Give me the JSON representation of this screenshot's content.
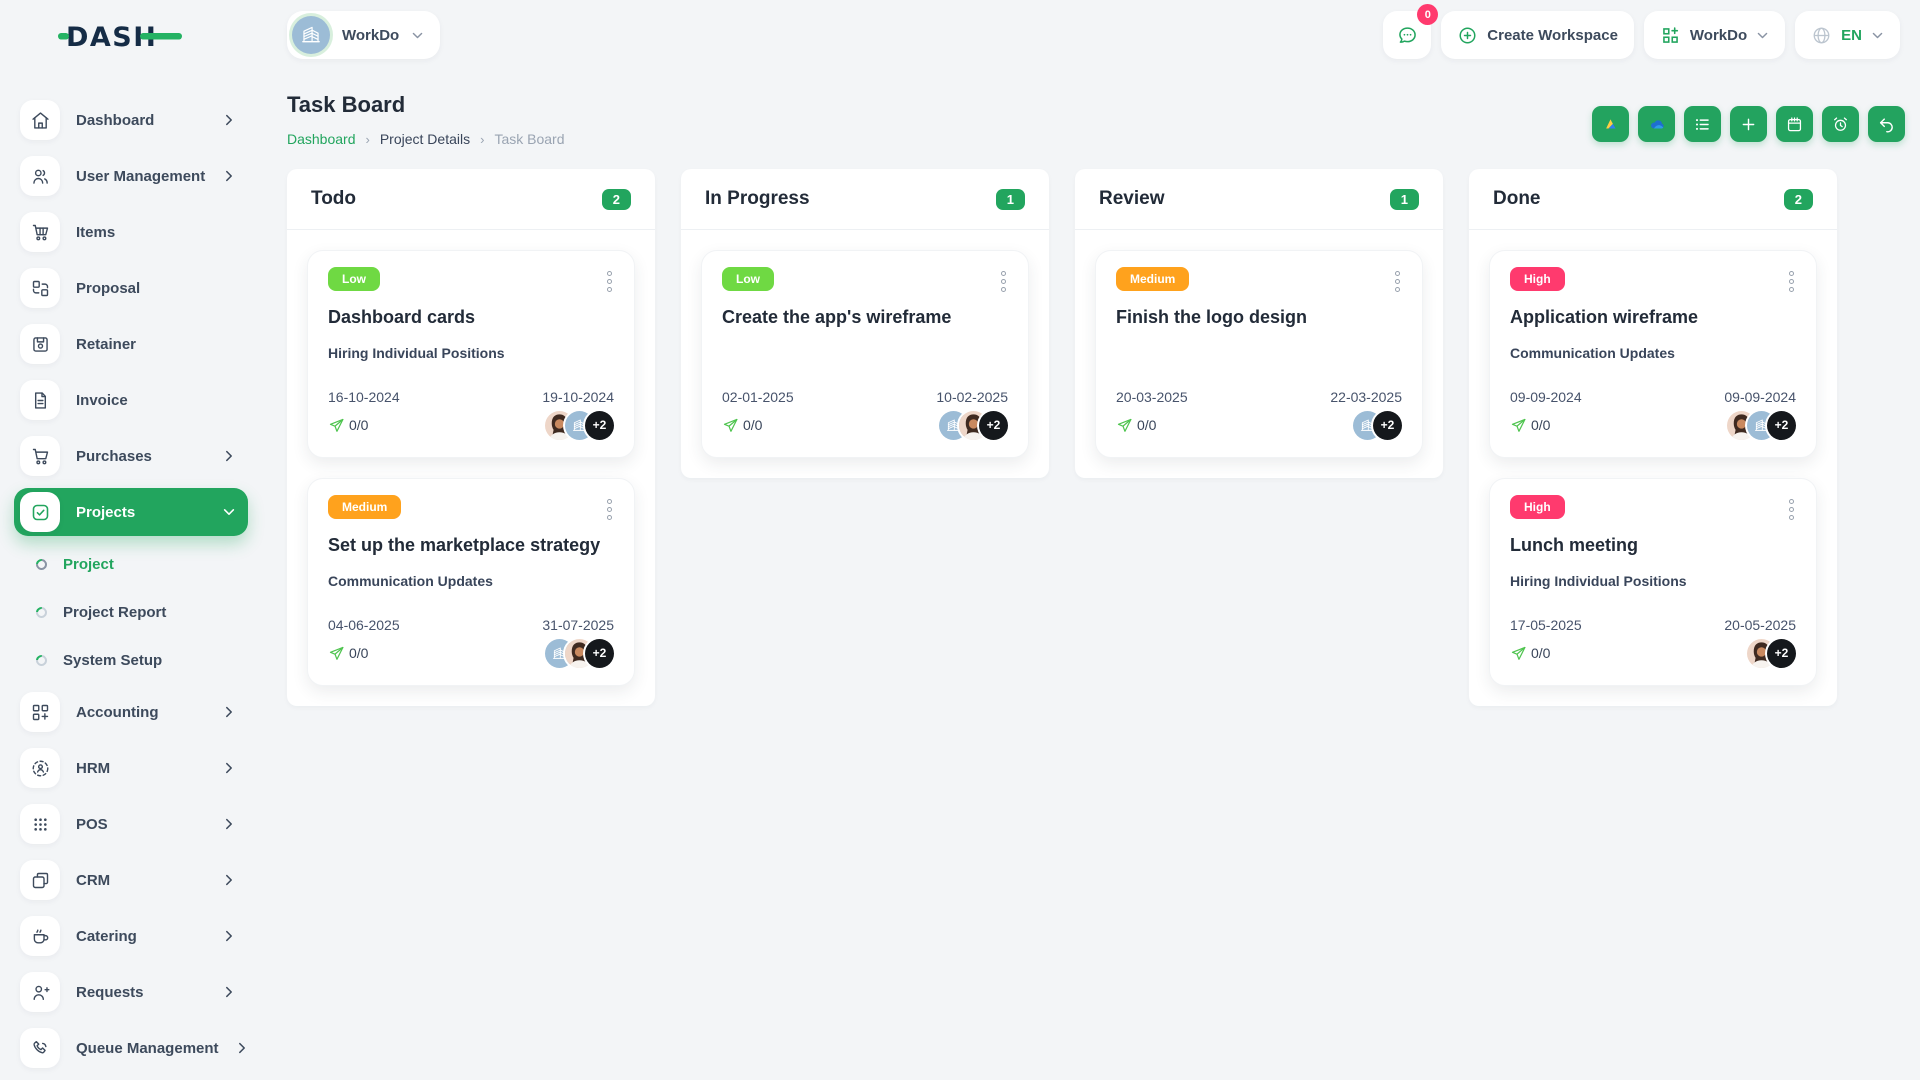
{
  "brand": {
    "logo_text": "DASH"
  },
  "header": {
    "workspace": {
      "label": "WorkDo"
    },
    "chat": {
      "badge": "0"
    },
    "create_workspace": {
      "label": "Create Workspace"
    },
    "app_switcher": {
      "label": "WorkDo"
    },
    "language": {
      "label": "EN"
    }
  },
  "sidebar": {
    "items": [
      {
        "label": "Dashboard"
      },
      {
        "label": "User Management"
      },
      {
        "label": "Items"
      },
      {
        "label": "Proposal"
      },
      {
        "label": "Retainer"
      },
      {
        "label": "Invoice"
      },
      {
        "label": "Purchases"
      },
      {
        "label": "Projects",
        "children": [
          {
            "label": "Project"
          },
          {
            "label": "Project Report"
          },
          {
            "label": "System Setup"
          }
        ]
      },
      {
        "label": "Accounting"
      },
      {
        "label": "HRM"
      },
      {
        "label": "POS"
      },
      {
        "label": "CRM"
      },
      {
        "label": "Catering"
      },
      {
        "label": "Requests"
      },
      {
        "label": "Queue Management"
      }
    ]
  },
  "page": {
    "title": "Task Board",
    "breadcrumb": [
      {
        "label": "Dashboard"
      },
      {
        "label": "Project Details"
      },
      {
        "label": "Task Board"
      }
    ]
  },
  "toolbar": {
    "buttons": [
      "google-drive",
      "onedrive",
      "list-view",
      "add-task",
      "calendar",
      "duration",
      "back"
    ]
  },
  "board": {
    "columns": [
      {
        "title": "Todo",
        "count": "2",
        "cards": [
          {
            "priority": "Low",
            "priority_level": "low",
            "title": "Dashboard cards",
            "subtitle": "Hiring Individual Positions",
            "start_date": "16-10-2024",
            "end_date": "19-10-2024",
            "progress": "0/0",
            "avatars": [
              {
                "type": "user-photo"
              },
              {
                "type": "workspace-logo"
              },
              {
                "type": "more",
                "label": "+2"
              }
            ]
          },
          {
            "priority": "Medium",
            "priority_level": "medium",
            "title": "Set up the marketplace strategy",
            "subtitle": "Communication Updates",
            "start_date": "04-06-2025",
            "end_date": "31-07-2025",
            "progress": "0/0",
            "avatars": [
              {
                "type": "workspace-logo"
              },
              {
                "type": "user-photo"
              },
              {
                "type": "more",
                "label": "+2"
              }
            ]
          }
        ]
      },
      {
        "title": "In Progress",
        "count": "1",
        "cards": [
          {
            "priority": "Low",
            "priority_level": "low",
            "title": "Create the app's wireframe",
            "subtitle": "",
            "start_date": "02-01-2025",
            "end_date": "10-02-2025",
            "progress": "0/0",
            "avatars": [
              {
                "type": "workspace-logo"
              },
              {
                "type": "user-photo"
              },
              {
                "type": "more",
                "label": "+2"
              }
            ]
          }
        ]
      },
      {
        "title": "Review",
        "count": "1",
        "cards": [
          {
            "priority": "Medium",
            "priority_level": "medium",
            "title": "Finish the logo design",
            "subtitle": "",
            "start_date": "20-03-2025",
            "end_date": "22-03-2025",
            "progress": "0/0",
            "avatars": [
              {
                "type": "workspace-logo"
              },
              {
                "type": "more",
                "label": "+2"
              }
            ]
          }
        ]
      },
      {
        "title": "Done",
        "count": "2",
        "cards": [
          {
            "priority": "High",
            "priority_level": "high",
            "title": "Application wireframe",
            "subtitle": "Communication Updates",
            "start_date": "09-09-2024",
            "end_date": "09-09-2024",
            "progress": "0/0",
            "avatars": [
              {
                "type": "user-photo"
              },
              {
                "type": "workspace-logo"
              },
              {
                "type": "more",
                "label": "+2"
              }
            ]
          },
          {
            "priority": "High",
            "priority_level": "high",
            "title": "Lunch meeting",
            "subtitle": "Hiring Individual Positions",
            "start_date": "17-05-2025",
            "end_date": "20-05-2025",
            "progress": "0/0",
            "avatars": [
              {
                "type": "user-photo"
              },
              {
                "type": "more",
                "label": "+2"
              }
            ]
          }
        ]
      }
    ]
  },
  "colors": {
    "primary": "#22a55e",
    "low": "#6fd943",
    "medium": "#ffa21d",
    "high": "#ff3a6e",
    "badge": "#ff3a6e"
  }
}
